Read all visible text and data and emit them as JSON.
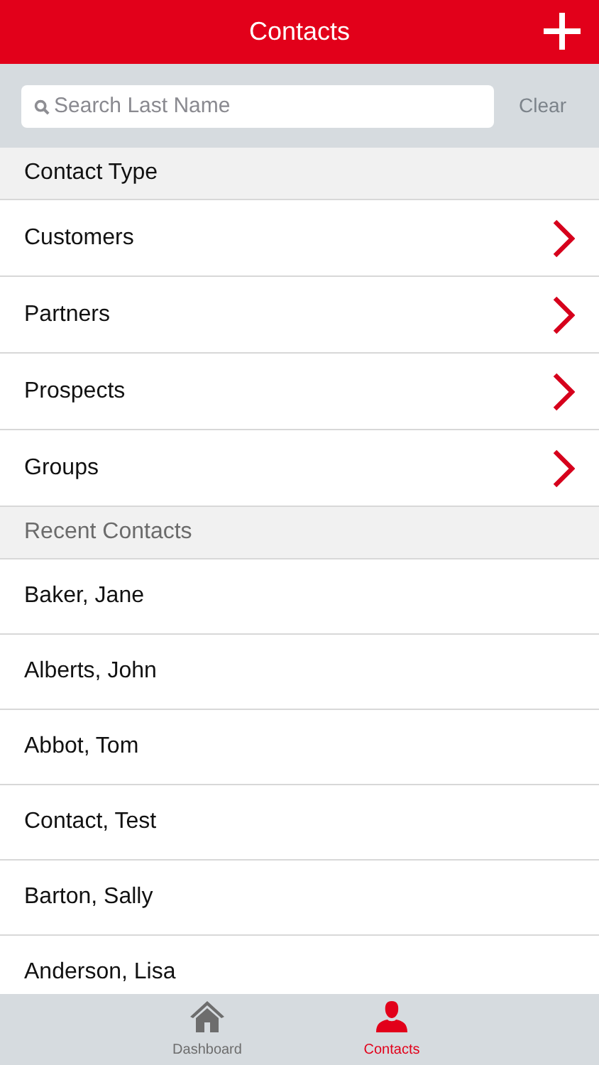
{
  "header": {
    "title": "Contacts"
  },
  "search": {
    "placeholder": "Search Last Name",
    "clear": "Clear"
  },
  "sections": [
    {
      "title": "Contact Type",
      "muted": false,
      "items": [
        {
          "label": "Customers",
          "chevron": true
        },
        {
          "label": "Partners",
          "chevron": true
        },
        {
          "label": "Prospects",
          "chevron": true
        },
        {
          "label": "Groups",
          "chevron": true
        }
      ]
    },
    {
      "title": "Recent Contacts",
      "muted": true,
      "items": [
        {
          "label": "Baker, Jane",
          "chevron": false
        },
        {
          "label": "Alberts, John",
          "chevron": false
        },
        {
          "label": "Abbot, Tom",
          "chevron": false
        },
        {
          "label": "Contact, Test",
          "chevron": false
        },
        {
          "label": "Barton, Sally",
          "chevron": false
        },
        {
          "label": "Anderson, Lisa",
          "chevron": false
        }
      ]
    }
  ],
  "tabs": [
    {
      "label": "Dashboard",
      "kind": "home",
      "selected": false
    },
    {
      "label": "Contacts",
      "kind": "person",
      "selected": true
    }
  ]
}
